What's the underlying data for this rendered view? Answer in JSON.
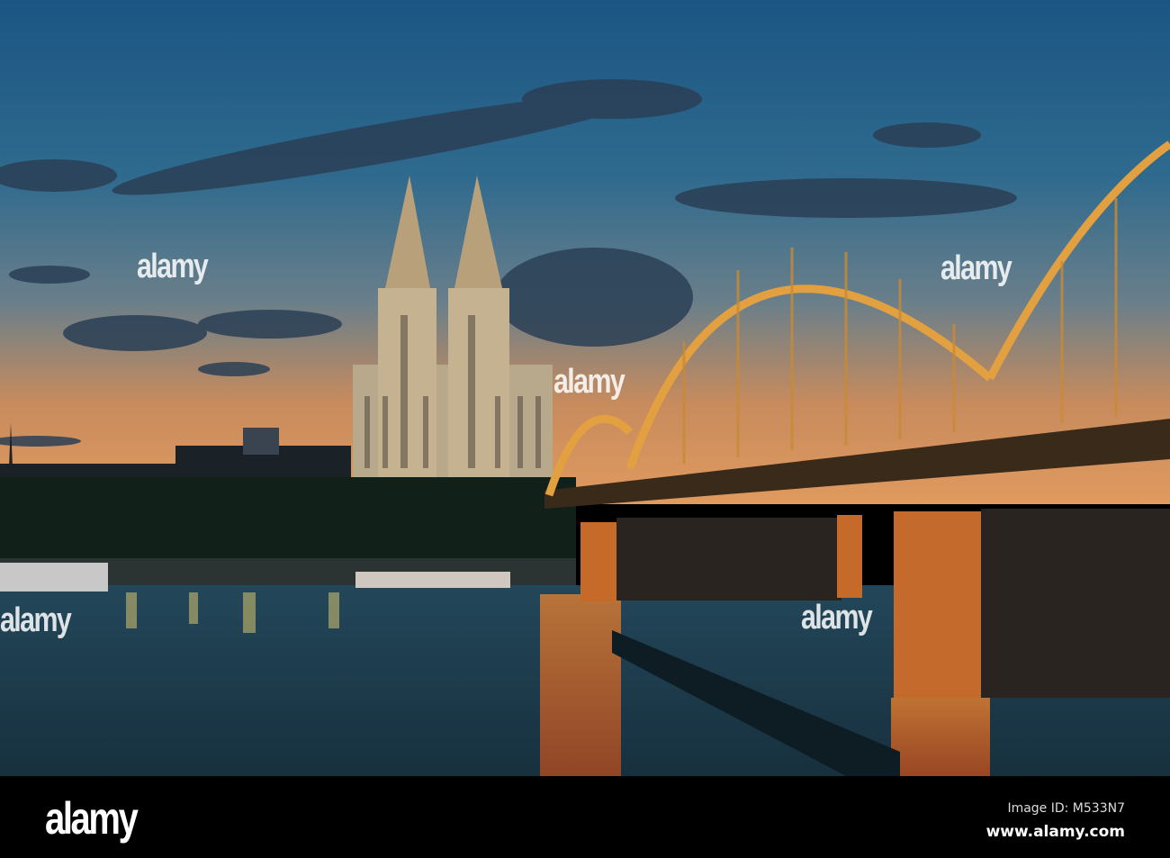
{
  "photo": {
    "subject": "Cologne Cathedral and Hohenzollern Bridge at dusk",
    "watermark_text": "alamy"
  },
  "footer": {
    "logo": "alamy",
    "image_id": "Image ID: M533N7",
    "url": "www.alamy.com"
  },
  "colors": {
    "sky_top": "#1d5784",
    "horizon": "#d9935a",
    "water": "#1b3342",
    "bridge_light": "#e8a040"
  }
}
